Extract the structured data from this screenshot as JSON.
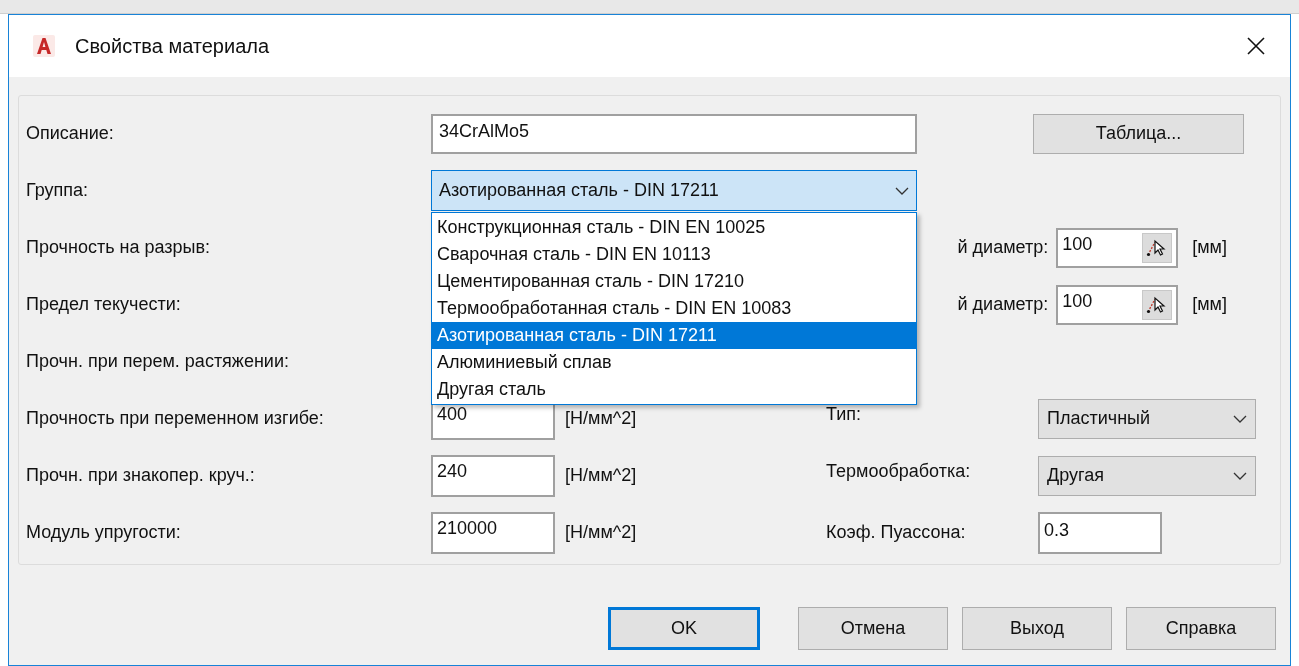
{
  "window": {
    "title": "Свойства материала"
  },
  "description": {
    "label": "Описание:",
    "value": "34CrAlMo5"
  },
  "table_button": "Таблица...",
  "group": {
    "label": "Группа:",
    "value": "Азотированная сталь - DIN 17211",
    "expanded": true,
    "options": [
      {
        "label": "Конструкционная сталь - DIN EN 10025",
        "selected": false
      },
      {
        "label": "Сварочная сталь - DIN EN 10113",
        "selected": false
      },
      {
        "label": "Цементированная сталь - DIN 17210",
        "selected": false
      },
      {
        "label": "Термообработанная сталь - DIN EN 10083",
        "selected": false
      },
      {
        "label": "Азотированная сталь - DIN 17211",
        "selected": true
      },
      {
        "label": "Алюминиевый сплав",
        "selected": false
      },
      {
        "label": "Другая сталь",
        "selected": false
      }
    ]
  },
  "properties": [
    {
      "label": "Прочность на разрыв:"
    },
    {
      "label": "Предел текучести:"
    },
    {
      "label": "Прочн. при перем. растяжении:"
    },
    {
      "label": "Прочность при переменном изгибе:",
      "value": "400",
      "unit": "[Н/мм^2]"
    },
    {
      "label": "Прочн. при знакопер. круч.:",
      "value": "240",
      "unit": "[Н/мм^2]"
    },
    {
      "label": "Модуль упругости:",
      "value": "210000",
      "unit": "[Н/мм^2]"
    }
  ],
  "right_fields": [
    {
      "kind": "diameter",
      "label": "й диаметр:",
      "value": "100",
      "unit": "[мм]"
    },
    {
      "kind": "diameter",
      "label": "й диаметр:",
      "value": "100",
      "unit": "[мм]"
    },
    {
      "kind": "select",
      "label": "Тип:",
      "value": "Пластичный"
    },
    {
      "kind": "select",
      "label": "Термообработка:",
      "value": "Другая"
    },
    {
      "kind": "input",
      "label": "Коэф. Пуассона:",
      "value": "0.3"
    }
  ],
  "buttons": [
    {
      "label": "OK",
      "default": true
    },
    {
      "label": "Отмена",
      "default": false
    },
    {
      "label": "Выход",
      "default": false
    },
    {
      "label": "Справка",
      "default": false
    }
  ]
}
